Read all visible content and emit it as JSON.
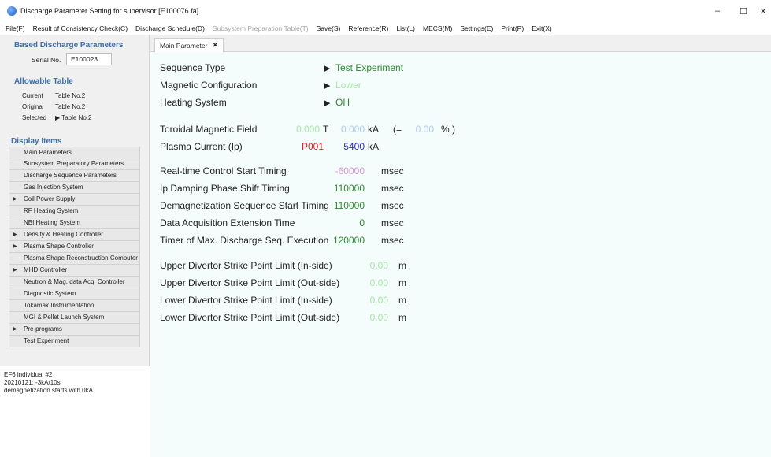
{
  "window": {
    "title": "Discharge Parameter Setting for supervisor [E100076.fa]",
    "minimize_glyph": "–",
    "maximize_glyph": "☐",
    "close_glyph": "✕"
  },
  "menu": [
    {
      "label": "File(F)",
      "enabled": true
    },
    {
      "label": "Result of Consistency Check(C)",
      "enabled": true
    },
    {
      "label": "Discharge Schedule(D)",
      "enabled": true
    },
    {
      "label": "Subsystem Preparation Table(T)",
      "enabled": false
    },
    {
      "label": "Save(S)",
      "enabled": true
    },
    {
      "label": "Reference(R)",
      "enabled": true
    },
    {
      "label": "List(L)",
      "enabled": true
    },
    {
      "label": "MECS(M)",
      "enabled": true
    },
    {
      "label": "Settings(E)",
      "enabled": true
    },
    {
      "label": "Print(P)",
      "enabled": true
    },
    {
      "label": "Exit(X)",
      "enabled": true
    }
  ],
  "left": {
    "based_heading": "Based Discharge Parameters",
    "serial_label": "Serial No.",
    "serial_value": "E100023",
    "allowable_heading": "Allowable Table",
    "table_rows": [
      {
        "key": "Current",
        "value": "Table No.2"
      },
      {
        "key": "Original",
        "value": "Table No.2"
      },
      {
        "key": "Selected",
        "value": "▶ Table No.2"
      }
    ],
    "display_heading": "Display Items",
    "display_items": [
      {
        "label": "Main Parameters",
        "expandable": false
      },
      {
        "label": "Subsystem Preparatory Parameters",
        "expandable": false
      },
      {
        "label": "Discharge Sequence Parameters",
        "expandable": false
      },
      {
        "label": "Gas Injection System",
        "expandable": false
      },
      {
        "label": "Coil Power Supply",
        "expandable": true
      },
      {
        "label": "RF Heating System",
        "expandable": false
      },
      {
        "label": "NBI Heating System",
        "expandable": false
      },
      {
        "label": "Density & Heating Controller",
        "expandable": true
      },
      {
        "label": "Plasma Shape Controller",
        "expandable": true
      },
      {
        "label": "Plasma Shape Reconstruction Computer",
        "expandable": false
      },
      {
        "label": "MHD Controller",
        "expandable": true
      },
      {
        "label": "Neutron & Mag. data Acq. Controller",
        "expandable": false
      },
      {
        "label": "Diagnostic System",
        "expandable": false
      },
      {
        "label": "Tokamak Instrumentation",
        "expandable": false
      },
      {
        "label": "MGI & Pellet Launch System",
        "expandable": false
      },
      {
        "label": "Pre-programs",
        "expandable": true
      },
      {
        "label": "Test Experiment",
        "expandable": false
      }
    ],
    "notes": [
      "EF6 individual #2",
      "20210121: -3kA/10s",
      "demagnetization starts with 0kA"
    ]
  },
  "tab": {
    "label": "Main Parameter",
    "close_glyph": "✕"
  },
  "main": {
    "sequence_type_label": "Sequence Type",
    "sequence_type_value": "Test Experiment",
    "magnetic_config_label": "Magnetic Configuration",
    "magnetic_config_value": "Lower",
    "heating_label": "Heating System",
    "heating_value": "OH",
    "arrow": "▶",
    "toroidal_label": "Toroidal Magnetic Field",
    "toroidal_T": "0.000",
    "unit_T": "T",
    "toroidal_kA": "0.000",
    "unit_kA": "kA",
    "pct_open": "(=",
    "toroidal_pct": "0.00",
    "pct_close": "% )",
    "ip_label": "Plasma Current (Ip)",
    "ip_code": "P001",
    "ip_value": "5400",
    "ip_unit": "kA",
    "timings": [
      {
        "label": "Real-time Control Start Timing",
        "value": "-60000",
        "unit": "msec"
      },
      {
        "label": "Ip Damping Phase Shift Timing",
        "value": "110000",
        "unit": "msec"
      },
      {
        "label": "Demagnetization Sequence Start Timing",
        "value": "110000",
        "unit": "msec"
      },
      {
        "label": "Data Acquisition Extension Time",
        "value": "0",
        "unit": "msec"
      },
      {
        "label": "Timer of Max. Discharge Seq. Execution",
        "value": "120000",
        "unit": "msec"
      }
    ],
    "limits": [
      {
        "label": "Upper Divertor Strike Point Limit (In-side)",
        "value": "0.00",
        "unit": "m"
      },
      {
        "label": "Upper Divertor Strike Point Limit (Out-side)",
        "value": "0.00",
        "unit": "m"
      },
      {
        "label": "Lower Divertor Strike Point Limit (In-side)",
        "value": "0.00",
        "unit": "m"
      },
      {
        "label": "Lower Divertor Strike Point Limit (Out-side)",
        "value": "0.00",
        "unit": "m"
      }
    ]
  }
}
